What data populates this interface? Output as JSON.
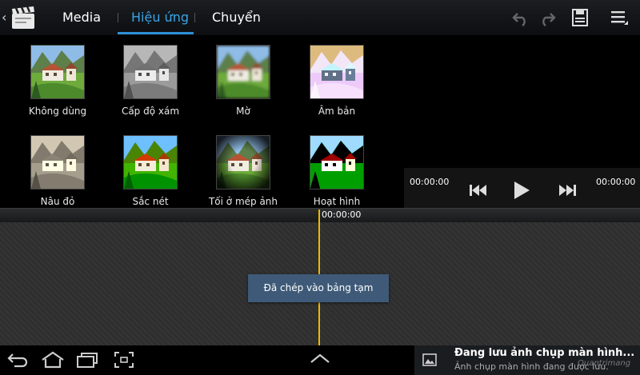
{
  "tabs": [
    {
      "label": "Media",
      "active": false
    },
    {
      "label": "Hiệu ứng",
      "active": true
    },
    {
      "label": "Chuyển",
      "active": false
    }
  ],
  "toolbar": {
    "icons": [
      "undo-icon",
      "redo-icon",
      "save-icon",
      "menu-icon"
    ]
  },
  "effects": [
    {
      "label": "Không dùng",
      "style": "normal"
    },
    {
      "label": "Cấp độ xám",
      "style": "grayscale"
    },
    {
      "label": "Mờ",
      "style": "blur"
    },
    {
      "label": "Âm bản",
      "style": "negative"
    },
    {
      "label": "Nâu đỏ",
      "style": "sepia"
    },
    {
      "label": "Sắc nét",
      "style": "sharpen"
    },
    {
      "label": "Tối ở mép ảnh",
      "style": "vignette"
    },
    {
      "label": "Hoạt hình",
      "style": "cartoon"
    }
  ],
  "player": {
    "start_time": "00:00:00",
    "end_time": "00:00:00",
    "controls": [
      "rewind-icon",
      "play-icon",
      "fast-forward-icon"
    ]
  },
  "timeline": {
    "playhead_time": "00:00:00"
  },
  "toast": {
    "message": "Đã chép vào bảng tạm"
  },
  "notification": {
    "title": "Đang lưu ảnh chụp màn hình...",
    "subtitle": "Ảnh chụp màn hình đang được lưu."
  },
  "watermark": "Quantrimang",
  "colors": {
    "accent": "#3aa3e8",
    "playhead": "#f0b800",
    "toast_bg": "#3e5a78"
  }
}
